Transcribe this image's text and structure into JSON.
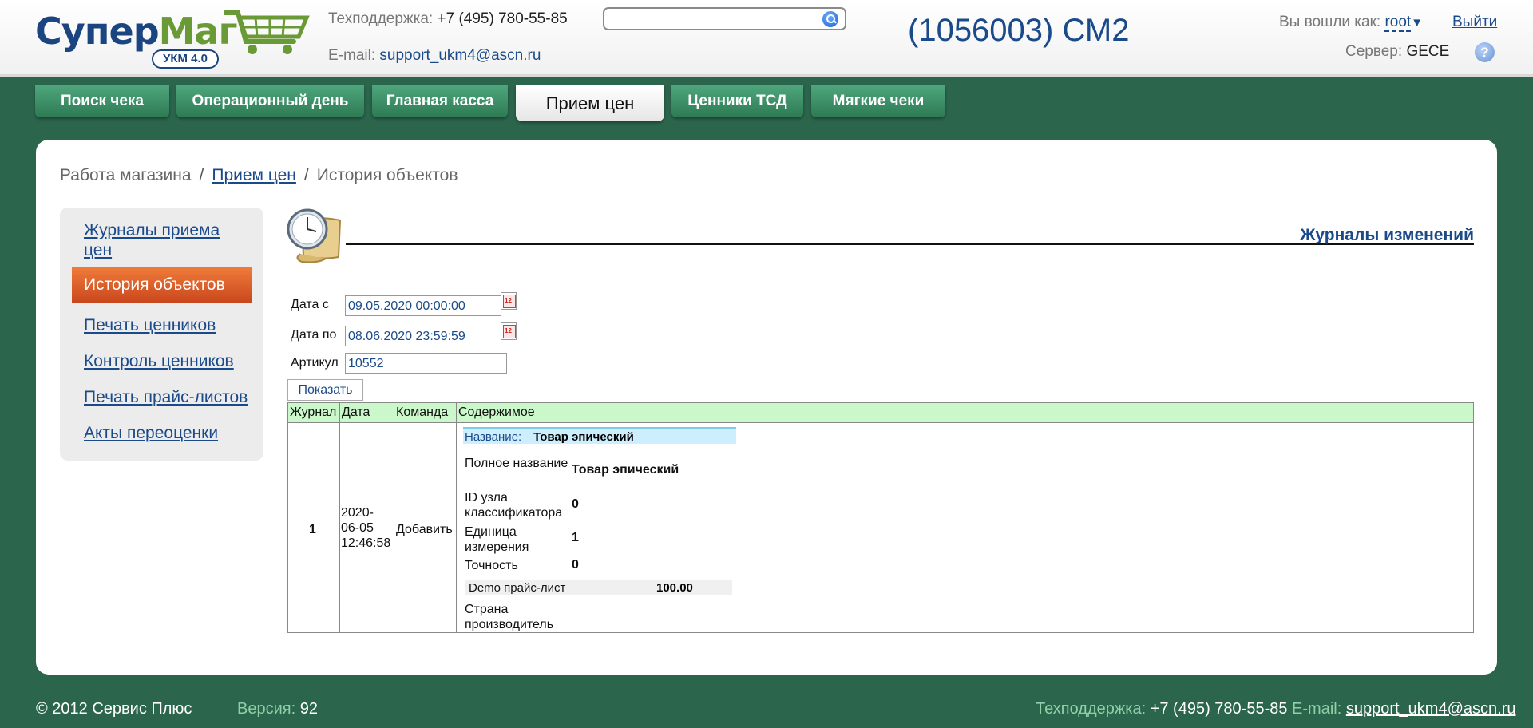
{
  "header": {
    "logo_main": "Супер",
    "logo_accent": "Маг",
    "logo_badge": "УКМ 4.0",
    "support_label": "Техподдержка:",
    "support_phone": "+7 (495) 780-55-85",
    "email_label": "E-mail:",
    "email_value": "support_ukm4@ascn.ru",
    "search_value": "",
    "store_name": "(1056003) СМ2",
    "logged_in_label": "Вы вошли как:",
    "username": "root",
    "logout_label": "Выйти",
    "server_label": "Сервер:",
    "server_value": "GECE",
    "help_glyph": "?"
  },
  "tabs": [
    {
      "label": "Поиск чека",
      "active": false
    },
    {
      "label": "Операционный день",
      "active": false
    },
    {
      "label": "Главная касса",
      "active": false
    },
    {
      "label": "Прием цен",
      "active": true
    },
    {
      "label": "Ценники ТСД",
      "active": false
    },
    {
      "label": "Мягкие чеки",
      "active": false
    }
  ],
  "breadcrumb": {
    "root": "Работа магазина",
    "separator": "/",
    "section": "Прием цен",
    "current": "История объектов"
  },
  "sidebar": {
    "items": [
      {
        "label": "Журналы приема цен",
        "active": false
      },
      {
        "label": "История объектов",
        "active": true
      },
      {
        "label": "Печать ценников",
        "active": false
      },
      {
        "label": "Контроль ценников",
        "active": false
      },
      {
        "label": "Печать прайс-листов",
        "active": false
      },
      {
        "label": "Акты переоценки",
        "active": false
      }
    ]
  },
  "main": {
    "title": "Журналы изменений",
    "form": {
      "date_from_label": "Дата с",
      "date_from_value": "09.05.2020 00:00:00",
      "date_to_label": "Дата по",
      "date_to_value": "08.06.2020 23:59:59",
      "article_label": "Артикул",
      "article_value": "10552",
      "show_button": "Показать"
    },
    "table": {
      "headers": [
        "Журнал",
        "Дата",
        "Команда",
        "Содержимое"
      ],
      "rows": [
        {
          "journal": "1",
          "date_lines": [
            "2020-",
            "06-05",
            "12:46:58"
          ],
          "command": "Добавить",
          "content": {
            "name_label": "Название:",
            "name_value": "Товар эпический",
            "properties": [
              {
                "label": "Полное название",
                "value": "Товар эпический"
              },
              {
                "label": "ID узла классификатора",
                "value": "0"
              },
              {
                "label": "Единица измерения",
                "value": "1"
              },
              {
                "label": "Точность",
                "value": "0"
              }
            ],
            "price_list_label": "Demo прайс-лист",
            "price_list_value": "100.00",
            "country_label": "Страна производитель",
            "country_value": ""
          }
        }
      ]
    }
  },
  "footer": {
    "copyright": "© 2012 Сервис Плюс",
    "version_label": "Версия:",
    "version_value": "92",
    "support_label": "Техподдержка:",
    "support_phone": "+7 (495) 780-55-85",
    "email_label": "E-mail:",
    "email_value": "support_ukm4@ascn.ru"
  },
  "colors": {
    "background": "#2b654c",
    "tab": "#3c9068",
    "accent_blue": "#1b4a8a",
    "active_orange": "#e0622b",
    "table_header": "#cbf8cb"
  }
}
